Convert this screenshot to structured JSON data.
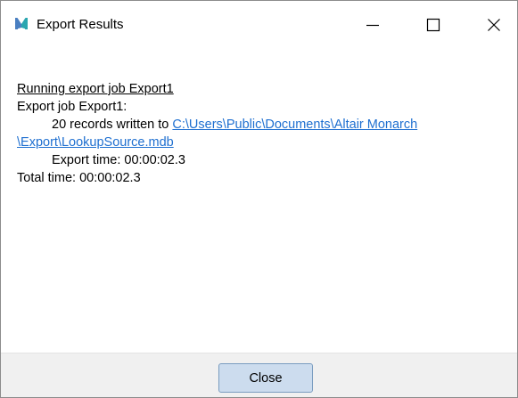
{
  "window": {
    "title": "Export Results",
    "icon": "monarch-m-logo-icon",
    "controls": {
      "minimize": "minimize-icon",
      "maximize": "maximize-icon",
      "close": "close-icon"
    }
  },
  "log": {
    "heading": "Running export job Export1",
    "job_line": "Export job Export1:",
    "records_prefix": "20 records written to ",
    "path_part1": "C:\\Users\\Public\\Documents\\Altair Monarch",
    "path_part2": "\\Export\\LookupSource.mdb",
    "export_time": "Export time: 00:00:02.3",
    "total_time": "Total time: 00:00:02.3"
  },
  "footer": {
    "close_label": "Close"
  },
  "colors": {
    "link": "#1e6fd0",
    "footer_bg": "#f0f0f0",
    "button_bg": "#ccdcee",
    "button_border": "#7a9cc0",
    "logo_left": "#4a7fc1",
    "logo_right": "#2aa6b0"
  }
}
